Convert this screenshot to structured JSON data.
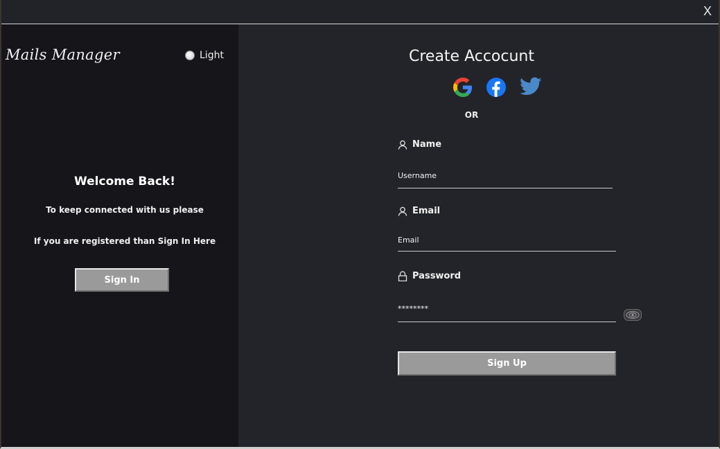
{
  "window": {
    "close_label": "X"
  },
  "left": {
    "app_title": "Mails Manager",
    "theme_option": "Light",
    "welcome_title": "Welcome Back!",
    "welcome_line1": "To keep connected with us please",
    "welcome_line2": "If you are registered than Sign In Here",
    "signin_label": "Sign In"
  },
  "right": {
    "title": "Create Accocunt",
    "social_icons": [
      "google-icon",
      "facebook-icon",
      "twitter-icon"
    ],
    "or_label": "OR",
    "name_label": "Name",
    "name_value": "Username",
    "email_label": "Email",
    "email_value": "Email",
    "password_label": "Password",
    "password_value": "********",
    "signup_label": "Sign Up"
  },
  "colors": {
    "left_panel_bg": "#16151a",
    "right_panel_bg": "#23242a",
    "button_bg": "#9a9a9a",
    "facebook": "#1877f2",
    "twitter": "#4a89c8"
  }
}
